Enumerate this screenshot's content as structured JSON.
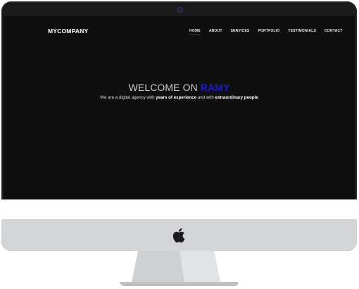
{
  "site": {
    "brand": "MYCOMPANY",
    "nav": [
      {
        "label": "HOME",
        "active": true
      },
      {
        "label": "ABOUT",
        "active": false
      },
      {
        "label": "SERVICES",
        "active": false
      },
      {
        "label": "PORTFOLIO",
        "active": false
      },
      {
        "label": "TESTIMONIALS",
        "active": false
      },
      {
        "label": "CONTACT",
        "active": false
      }
    ],
    "hero": {
      "title_prefix": "WELCOME ON ",
      "title_accent": "RAMY",
      "subtitle_1": "We are a digital agency with ",
      "subtitle_bold_1": "years of experience",
      "subtitle_2": " and with ",
      "subtitle_bold_2": "extraordinary people"
    }
  },
  "device": {
    "logo_icon": "apple-logo-icon"
  },
  "colors": {
    "screen_bg": "#0f0f10",
    "bezel": "#1b1b1d",
    "accent": "#1b1bcc",
    "chin": "#d4d5d7"
  }
}
